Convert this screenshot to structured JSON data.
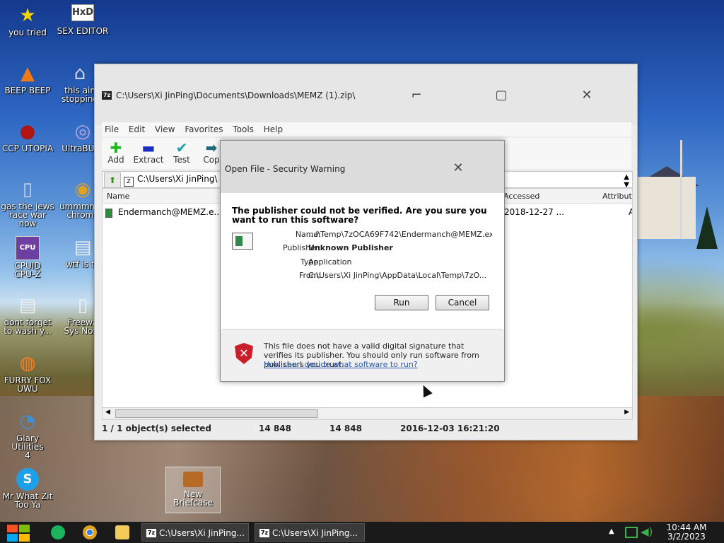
{
  "desktop": {
    "icons": [
      {
        "label": "you tried",
        "glyph": "★",
        "color": "#f5d400"
      },
      {
        "label": "SEX EDITOR",
        "glyph": "HxD",
        "color": "#f0a830"
      },
      {
        "label": "BEEP BEEP",
        "glyph": "▲",
        "color": "#f07b14"
      },
      {
        "label": "this ain\nstopping",
        "glyph": "⌂",
        "color": "#cfd7e3"
      },
      {
        "label": "CCP UTOPIA",
        "glyph": "●",
        "color": "#b01515"
      },
      {
        "label": "UltraBULL",
        "glyph": "◎",
        "color": "#bba6d6"
      },
      {
        "label": "gas the jews\nrace war now",
        "glyph": "▯",
        "color": "#c9d4df"
      },
      {
        "label": "ummmmm\nchrome",
        "glyph": "◉",
        "color": "#e0a020"
      },
      {
        "label": "CPUID\nCPU-Z",
        "glyph": "CPU",
        "color": "#6c3fa0"
      },
      {
        "label": "wtf is th",
        "glyph": "▤",
        "color": "#eeeeee"
      },
      {
        "label": "dont forget\nto wash y...",
        "glyph": "▤",
        "color": "#eeeeee"
      },
      {
        "label": "Freewa\nSys Note",
        "glyph": "▯",
        "color": "#f2f2f2"
      },
      {
        "label": "FURRY FOX\nUWU",
        "glyph": "◍",
        "color": "#ff7a1a"
      },
      {
        "label": "Glary Utilities\n4",
        "glyph": "◔",
        "color": "#3a8fe0"
      },
      {
        "label": "Mr What Zit\nToo Ya",
        "glyph": "S",
        "color": "#1ea0e8"
      }
    ],
    "briefcase_label": "New\nBriefcase"
  },
  "window": {
    "app_icon": "7z",
    "title": "C:\\Users\\Xi JinPing\\Documents\\Downloads\\MEMZ (1).zip\\",
    "menu": [
      "File",
      "Edit",
      "View",
      "Favorites",
      "Tools",
      "Help"
    ],
    "tools": [
      {
        "label": "Add",
        "icon": "plus-icon",
        "glyph": "✚",
        "color": "#1fb51f"
      },
      {
        "label": "Extract",
        "icon": "minus-icon",
        "glyph": "▬",
        "color": "#1a2fbf"
      },
      {
        "label": "Test",
        "icon": "check-icon",
        "glyph": "✔",
        "color": "#1aa0a6"
      },
      {
        "label": "Cop",
        "icon": "copy-arrow-icon",
        "glyph": "➡",
        "color": "#1f6b78"
      }
    ],
    "address": "C:\\Users\\Xi JinPing\\",
    "columns": {
      "name": "Name",
      "accessed": "Accessed",
      "attributes": "Attribute"
    },
    "rows": [
      {
        "name": "Endermanch@MEMZ.e...",
        "accessed": "2018-12-27 ...",
        "attr": "A"
      }
    ],
    "status": {
      "selected": "1 / 1 object(s) selected",
      "size": "14 848",
      "packed": "14 848",
      "modified": "2016-12-03 16:21:20"
    }
  },
  "dialog": {
    "title": "Open File - Security Warning",
    "question": "The publisher could not be verified.  Are you sure you want to run this software?",
    "fields": {
      "name_label": "Name:",
      "name": "...l\\Temp\\7zOCA69F742\\Endermanch@MEMZ.exe",
      "publisher_label": "Publisher:",
      "publisher": "Unknown Publisher",
      "type_label": "Type:",
      "type": "Application",
      "from_label": "From:",
      "from": "C:\\Users\\Xi JinPing\\AppData\\Local\\Temp\\7zO..."
    },
    "run_label": "Run",
    "cancel_label": "Cancel",
    "warning": "This file does not have a valid digital signature that verifies its publisher.  You should only run software from publishers you trust.",
    "help_link": "How can I decide what software to run?"
  },
  "taskbar": {
    "tasks": [
      {
        "icon": "7z",
        "label": "C:\\Users\\Xi JinPing..."
      },
      {
        "icon": "7z",
        "label": "C:\\Users\\Xi JinPing..."
      }
    ],
    "time": "10:44 AM",
    "date": "3/2/2023"
  }
}
